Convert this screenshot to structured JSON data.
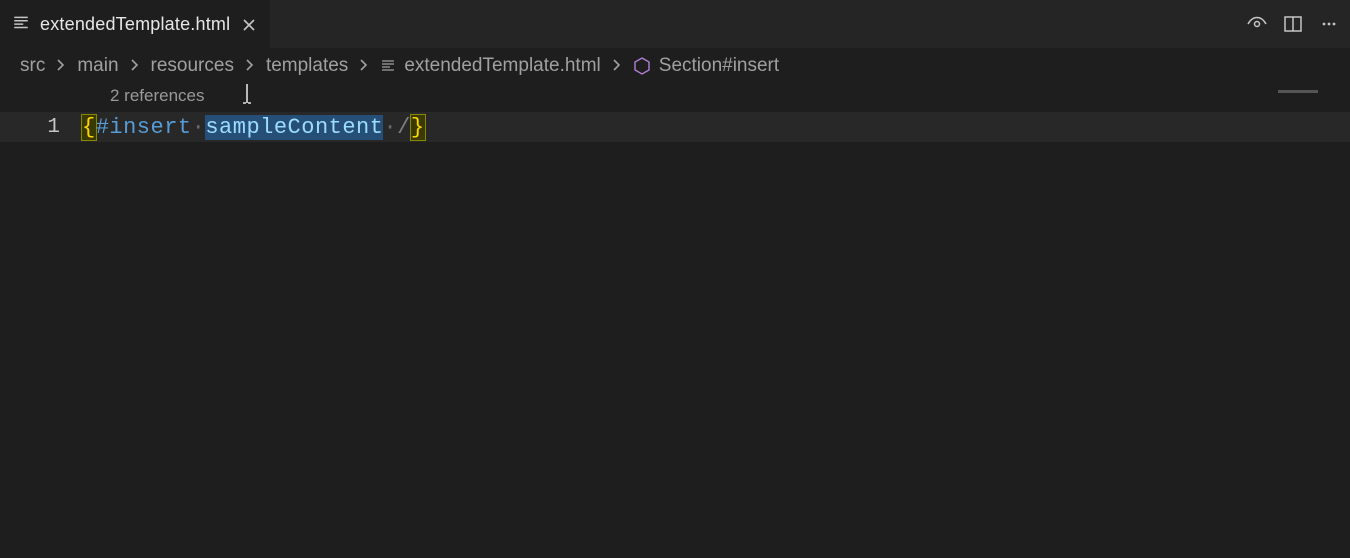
{
  "tab": {
    "filename": "extendedTemplate.html"
  },
  "breadcrumb": {
    "segments": [
      "src",
      "main",
      "resources",
      "templates",
      "extendedTemplate.html",
      "Section#insert"
    ]
  },
  "codelens": {
    "text": "2 references"
  },
  "editor": {
    "line_number": "1",
    "tokens": {
      "open_brace": "{",
      "directive": "#insert",
      "dot1": "·",
      "identifier": "sampleContent",
      "dot2": "·",
      "slash": "/",
      "close_brace": "}"
    }
  }
}
